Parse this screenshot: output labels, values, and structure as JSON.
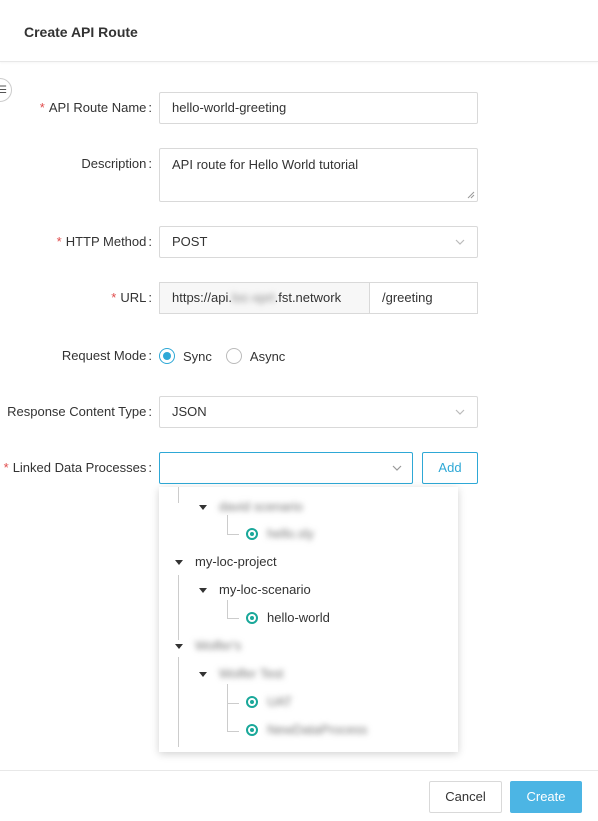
{
  "dialog": {
    "title": "Create API Route"
  },
  "form": {
    "route_name": {
      "label": "API Route Name",
      "value": "hello-world-greeting",
      "required": true
    },
    "description": {
      "label": "Description",
      "value": "API route for Hello World tutorial"
    },
    "http_method": {
      "label": "HTTP Method",
      "value": "POST",
      "required": true
    },
    "url": {
      "label": "URL",
      "prefix_start": "https://api.",
      "prefix_blurred": "loc-xprt",
      "prefix_end": ".fst.network",
      "path": "/greeting",
      "required": true
    },
    "request_mode": {
      "label": "Request Mode",
      "options": [
        "Sync",
        "Async"
      ],
      "selected": "Sync"
    },
    "response_content_type": {
      "label": "Response Content Type",
      "value": "JSON"
    },
    "linked_data_processes": {
      "label": "Linked Data Processes",
      "value": "",
      "add_label": "Add",
      "required": true
    }
  },
  "tree": {
    "items": [
      {
        "label": "david scenario",
        "blurred": true
      },
      {
        "label": "hello.sly",
        "blurred": true
      },
      {
        "label": "my-loc-project"
      },
      {
        "label": "my-loc-scenario"
      },
      {
        "label": "hello-world"
      },
      {
        "label": "Wolfer's",
        "blurred": true
      },
      {
        "label": "Wolfer Test",
        "blurred": true
      },
      {
        "label": "UAT",
        "blurred": true
      },
      {
        "label": "NewDataProcess",
        "blurred": true
      }
    ]
  },
  "footer": {
    "cancel_label": "Cancel",
    "create_label": "Create"
  },
  "colors": {
    "accent": "#2ea8d6",
    "required": "#e04b4b",
    "primary_button": "#4cb5e4"
  }
}
